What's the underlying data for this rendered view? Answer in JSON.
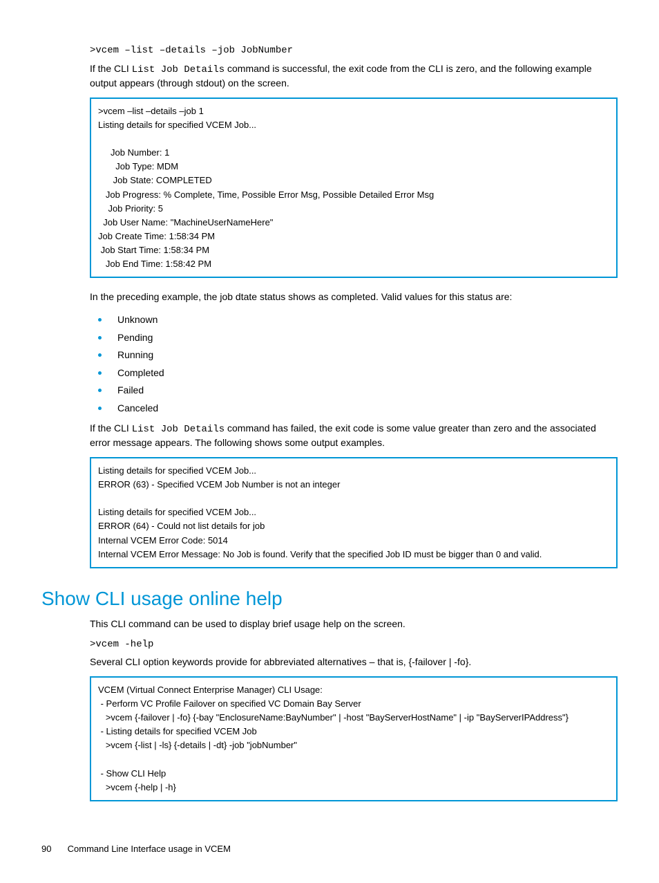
{
  "cmd1": ">vcem –list –details –job JobNumber",
  "para1_a": "If the CLI ",
  "para1_code": "List Job Details",
  "para1_b": " command is successful, the exit code from the CLI is zero, and the following example output appears (through stdout) on the screen.",
  "box1": {
    "l1": ">vcem –list –details –job 1",
    "l2": "Listing details for specified VCEM Job...",
    "l3": "     Job Number: 1",
    "l4": "       Job Type: MDM",
    "l5": "      Job State: COMPLETED",
    "l6": "   Job Progress: % Complete, Time, Possible Error Msg, Possible Detailed Error Msg",
    "l7": "    Job Priority: 5",
    "l8": "  Job User Name: \"MachineUserNameHere\"",
    "l9": "Job Create Time: 1:58:34 PM",
    "l10": " Job Start Time: 1:58:34 PM",
    "l11": "   Job End Time: 1:58:42 PM"
  },
  "para2": "In the preceding example, the job dtate status shows as completed. Valid values for this status are:",
  "bullets": [
    "Unknown",
    "Pending",
    "Running",
    "Completed",
    "Failed",
    "Canceled"
  ],
  "para3_a": "If the CLI ",
  "para3_code": "List Job Details",
  "para3_b": " command has failed, the exit code is some value greater than zero and the associated error message appears. The following shows some output examples.",
  "box2": {
    "l1": "Listing details for specified VCEM Job...",
    "l2": "ERROR (63) - Specified VCEM Job Number is not an integer",
    "l3": "Listing details for specified VCEM Job...",
    "l4": "ERROR (64) - Could not list details for job",
    "l5": "Internal VCEM Error Code: 5014",
    "l6": "Internal VCEM Error Message: No Job is found. Verify that the specified Job ID must be bigger than 0 and valid."
  },
  "heading": "Show CLI usage online help",
  "para4": "This CLI command can be used to display brief usage help on the screen.",
  "cmd2": ">vcem -help",
  "para5": "Several CLI option keywords provide for abbreviated alternatives – that is, {-failover | -fo}.",
  "box3": {
    "l1": "VCEM (Virtual Connect Enterprise Manager) CLI Usage:",
    "l2": " - Perform VC Profile Failover on specified VC Domain Bay Server",
    "l3": "   >vcem {-failover | -fo} {-bay \"EnclosureName:BayNumber\" | -host \"BayServerHostName\" | -ip \"BayServerIPAddress\"}",
    "l4": " - Listing details for specified VCEM Job",
    "l5": "   >vcem {-list | -ls} {-details | -dt} -job \"jobNumber\"",
    "l6": " - Show CLI Help",
    "l7": "   >vcem {-help | -h}"
  },
  "footer_page": "90",
  "footer_text": "Command Line Interface usage in VCEM"
}
